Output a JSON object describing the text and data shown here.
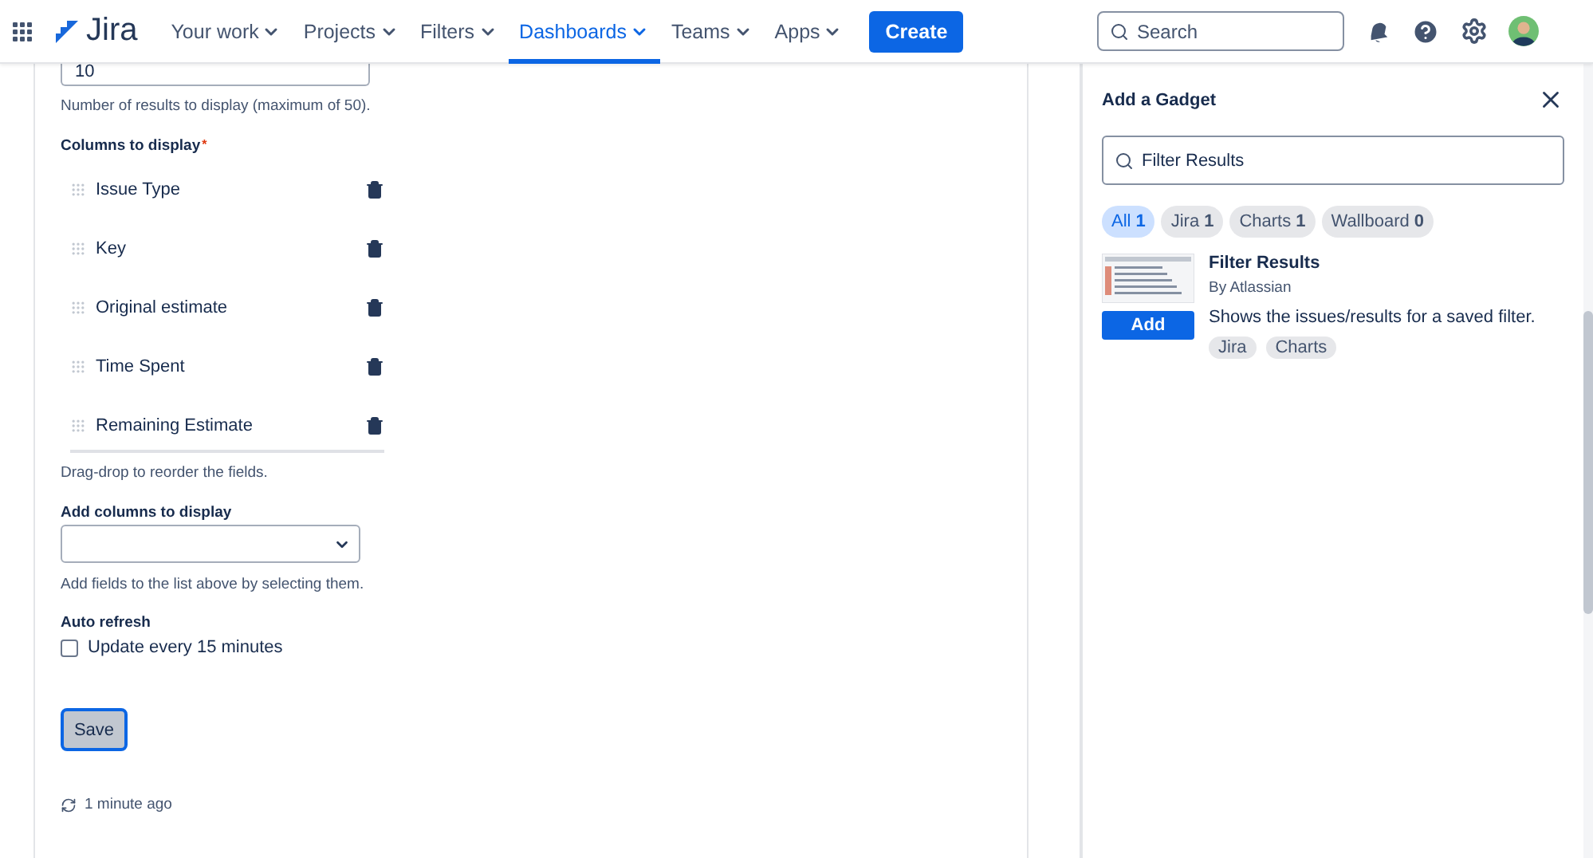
{
  "nav": {
    "logo": "Jira",
    "items": [
      {
        "label": "Your work",
        "selected": false
      },
      {
        "label": "Projects",
        "selected": false
      },
      {
        "label": "Filters",
        "selected": false
      },
      {
        "label": "Dashboards",
        "selected": true
      },
      {
        "label": "Teams",
        "selected": false
      },
      {
        "label": "Apps",
        "selected": false
      }
    ],
    "create": "Create",
    "search": {
      "placeholder": "Search"
    }
  },
  "form": {
    "results_field": {
      "value": "10"
    },
    "results_hint": "Number of results to display (maximum of 50).",
    "columns_label": "Columns to display",
    "required_mark": "*",
    "columns": [
      "Issue Type",
      "Key",
      "Original estimate",
      "Time Spent",
      "Remaining Estimate"
    ],
    "columns_hint": "Drag-drop to reorder the fields.",
    "add_label": "Add columns to display",
    "add_hint": "Add fields to the list above by selecting them.",
    "refresh_label": "Auto refresh",
    "refresh_option": {
      "label": "Update every 15 minutes",
      "checked": false
    },
    "save": "Save",
    "updated": "1 minute ago"
  },
  "gadget_panel": {
    "title": "Add a Gadget",
    "search": {
      "value": "Filter Results"
    },
    "filters": [
      {
        "label": "All",
        "count": "1",
        "selected": true
      },
      {
        "label": "Jira",
        "count": "1",
        "selected": false
      },
      {
        "label": "Charts",
        "count": "1",
        "selected": false
      },
      {
        "label": "Wallboard",
        "count": "0",
        "selected": false
      }
    ],
    "results": [
      {
        "title": "Filter Results",
        "author": "By Atlassian",
        "description": "Shows the issues/results for a saved filter.",
        "add": "Add",
        "tags": [
          "Jira",
          "Charts"
        ]
      }
    ]
  }
}
